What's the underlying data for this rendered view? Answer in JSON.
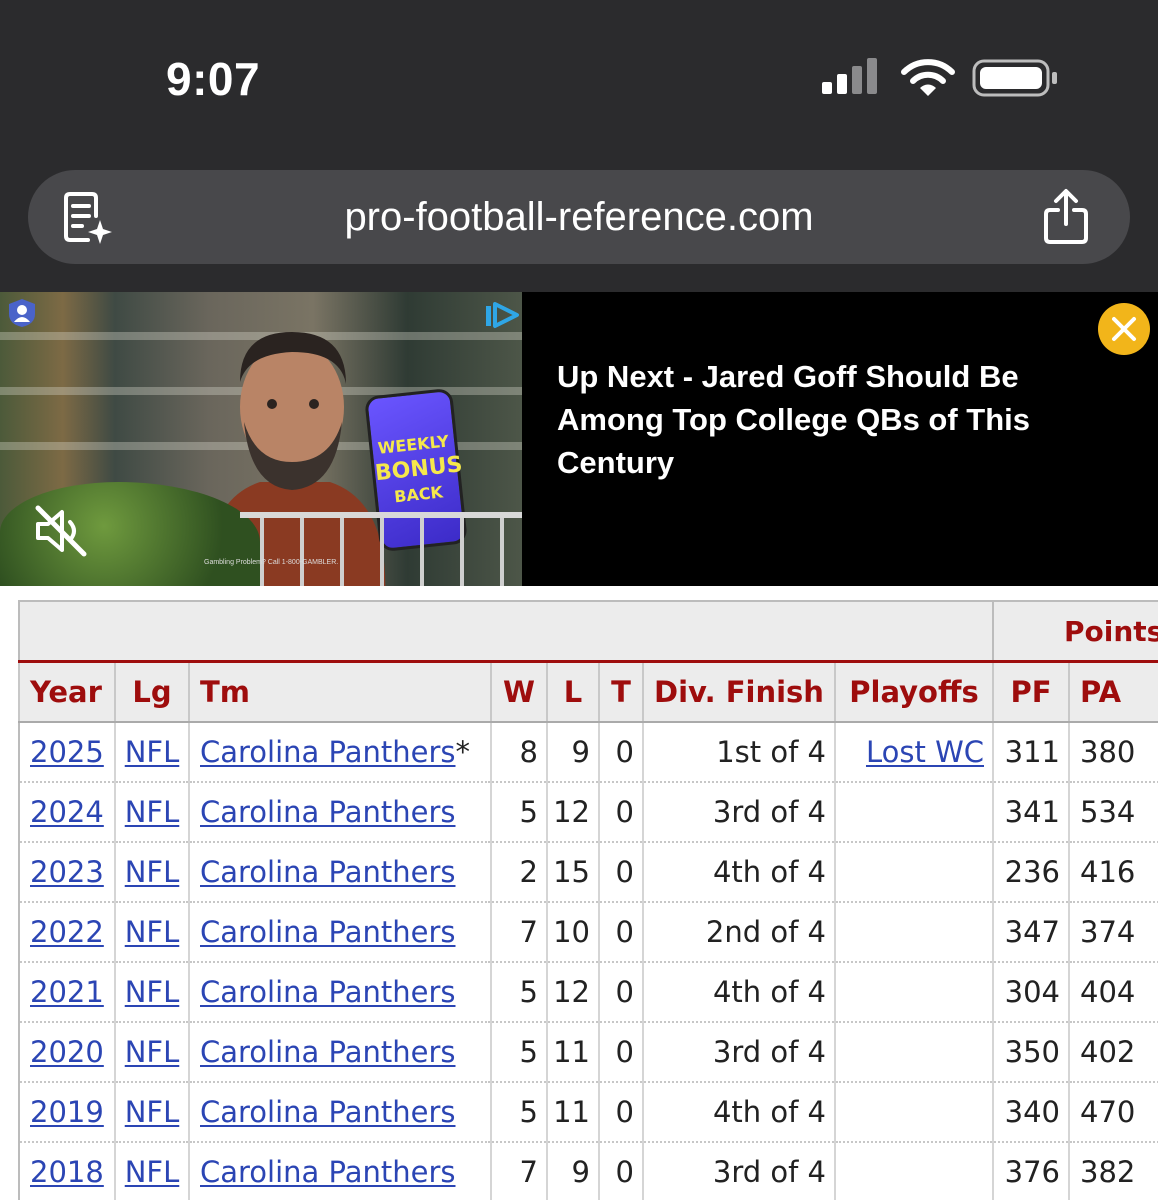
{
  "status_bar": {
    "time": "9:07"
  },
  "browser": {
    "url": "pro-football-reference.com"
  },
  "ad": {
    "phone_lines": [
      "WEEKLY",
      "BONUS",
      "BACK"
    ],
    "fine_print": "Gambling Problem? Call 1-800-GAMBLER.",
    "up_next_title": "Up Next - Jared Goff Should Be Among Top College QBs of This Century"
  },
  "table": {
    "over_header": "Points",
    "columns": [
      "Year",
      "Lg",
      "Tm",
      "W",
      "L",
      "T",
      "Div. Finish",
      "Playoffs",
      "PF",
      "PA"
    ],
    "rows": [
      {
        "year": "2025",
        "lg": "NFL",
        "tm": "Carolina Panthers",
        "star": "*",
        "w": "8",
        "l": "9",
        "t": "0",
        "div": "1st of 4",
        "playoffs": "Lost WC",
        "pf": "311",
        "pa": "380"
      },
      {
        "year": "2024",
        "lg": "NFL",
        "tm": "Carolina Panthers",
        "star": "",
        "w": "5",
        "l": "12",
        "t": "0",
        "div": "3rd of 4",
        "playoffs": "",
        "pf": "341",
        "pa": "534"
      },
      {
        "year": "2023",
        "lg": "NFL",
        "tm": "Carolina Panthers",
        "star": "",
        "w": "2",
        "l": "15",
        "t": "0",
        "div": "4th of 4",
        "playoffs": "",
        "pf": "236",
        "pa": "416"
      },
      {
        "year": "2022",
        "lg": "NFL",
        "tm": "Carolina Panthers",
        "star": "",
        "w": "7",
        "l": "10",
        "t": "0",
        "div": "2nd of 4",
        "playoffs": "",
        "pf": "347",
        "pa": "374"
      },
      {
        "year": "2021",
        "lg": "NFL",
        "tm": "Carolina Panthers",
        "star": "",
        "w": "5",
        "l": "12",
        "t": "0",
        "div": "4th of 4",
        "playoffs": "",
        "pf": "304",
        "pa": "404"
      },
      {
        "year": "2020",
        "lg": "NFL",
        "tm": "Carolina Panthers",
        "star": "",
        "w": "5",
        "l": "11",
        "t": "0",
        "div": "3rd of 4",
        "playoffs": "",
        "pf": "350",
        "pa": "402"
      },
      {
        "year": "2019",
        "lg": "NFL",
        "tm": "Carolina Panthers",
        "star": "",
        "w": "5",
        "l": "11",
        "t": "0",
        "div": "4th of 4",
        "playoffs": "",
        "pf": "340",
        "pa": "470"
      },
      {
        "year": "2018",
        "lg": "NFL",
        "tm": "Carolina Panthers",
        "star": "",
        "w": "7",
        "l": "9",
        "t": "0",
        "div": "3rd of 4",
        "playoffs": "",
        "pf": "376",
        "pa": "382"
      }
    ]
  },
  "colors": {
    "header_text": "#9e0d0d",
    "link": "#2b45b4",
    "close_button": "#f2b51a"
  },
  "icons": [
    "cellular-signal-icon",
    "wifi-icon",
    "battery-icon",
    "reader-mode-icon",
    "share-icon",
    "mute-icon",
    "adchoices-icon",
    "close-icon"
  ]
}
